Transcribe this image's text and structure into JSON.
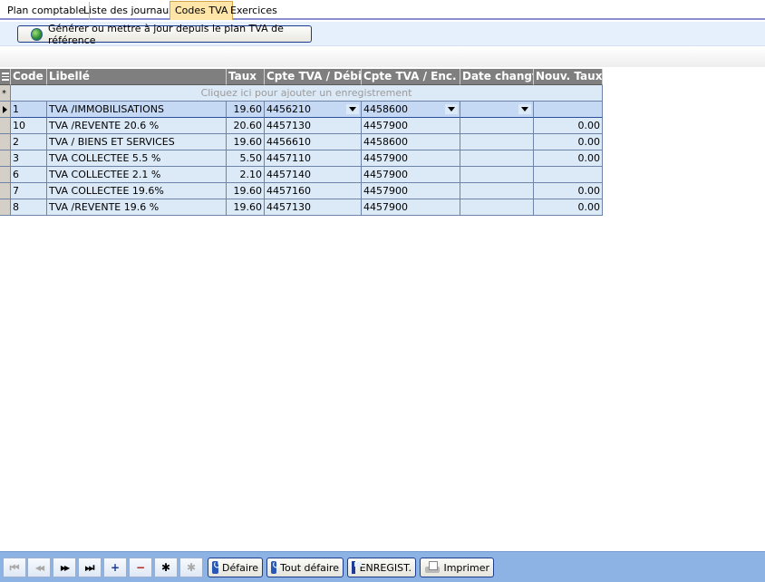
{
  "tabs": [
    {
      "label": "Plan comptable",
      "active": false
    },
    {
      "label": "Liste des journaux",
      "active": false
    },
    {
      "label": "Codes TVA",
      "active": true
    },
    {
      "label": "Exercices",
      "active": false
    }
  ],
  "toolbar": {
    "generate_label": "Générer ou mettre à jour depuis le plan TVA de référence"
  },
  "grid": {
    "headers": {
      "code": "Code",
      "libelle": "Libellé",
      "taux": "Taux",
      "cpte_debit": "Cpte TVA / Débit",
      "cpte_enc": "Cpte TVA / Enc.",
      "date_changt": "Date changt",
      "nouv_taux": "Nouv. Taux"
    },
    "new_row_hint": "Cliquez ici pour ajouter un enregistrement",
    "rows": [
      {
        "code": "1",
        "libelle": "TVA /IMMOBILISATIONS",
        "taux": "19.60",
        "debit": "4456210",
        "enc": "4458600",
        "date": "",
        "nouv": ""
      },
      {
        "code": "10",
        "libelle": "TVA /REVENTE  20.6 %",
        "taux": "20.60",
        "debit": "4457130",
        "enc": "4457900",
        "date": "",
        "nouv": "0.00"
      },
      {
        "code": "2",
        "libelle": "TVA / BIENS ET SERVICES",
        "taux": "19.60",
        "debit": "4456610",
        "enc": "4458600",
        "date": "",
        "nouv": "0.00"
      },
      {
        "code": "3",
        "libelle": "TVA COLLECTEE  5.5 %",
        "taux": "5.50",
        "debit": "4457110",
        "enc": "4457900",
        "date": "",
        "nouv": "0.00"
      },
      {
        "code": "6",
        "libelle": "TVA COLLECTEE  2.1 %",
        "taux": "2.10",
        "debit": "4457140",
        "enc": "4457900",
        "date": "",
        "nouv": ""
      },
      {
        "code": "7",
        "libelle": "TVA COLLECTEE 19.6%",
        "taux": "19.60",
        "debit": "4457160",
        "enc": "4457900",
        "date": "",
        "nouv": "0.00"
      },
      {
        "code": "8",
        "libelle": "TVA /REVENTE  19.6 %",
        "taux": "19.60",
        "debit": "4457130",
        "enc": "4457900",
        "date": "",
        "nouv": "0.00"
      }
    ]
  },
  "bottom": {
    "nav_first": "⏮",
    "nav_prev": "◀◀",
    "nav_next": "▶▶",
    "nav_last": "⏭",
    "nav_add": "+",
    "nav_delete": "−",
    "nav_edit": "✱",
    "nav_refresh": "✱",
    "undo_label": "Défaire",
    "undo_all_label": "Tout défaire",
    "save_label": "ENREGIST.",
    "print_label": "Imprimer"
  }
}
